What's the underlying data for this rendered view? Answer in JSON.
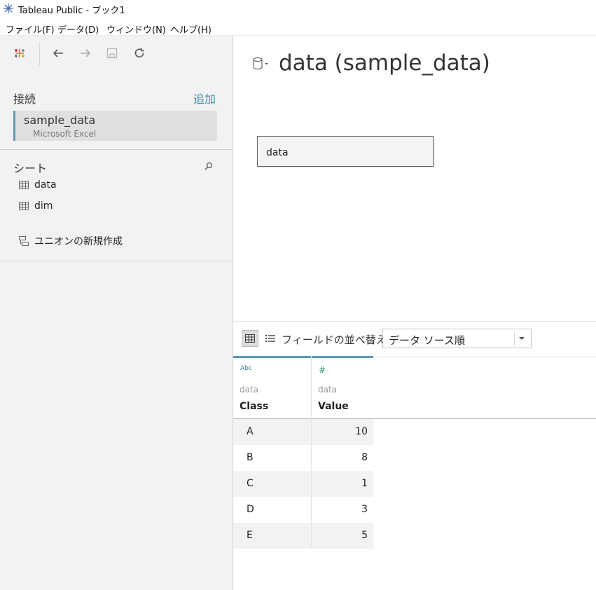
{
  "window": {
    "title": "Tableau Public - ブック1"
  },
  "menu": [
    "ファイル(F)",
    "データ(D)",
    "ウィンドウ(N)",
    "ヘルプ(H)"
  ],
  "toolbar": {
    "icons": [
      "tableau-logo-icon",
      "back-arrow-icon",
      "forward-arrow-icon",
      "save-icon",
      "refresh-icon"
    ]
  },
  "sidebar": {
    "connections_heading": "接続",
    "add_link": "追加",
    "connection": {
      "name": "sample_data",
      "type": "Microsoft Excel"
    },
    "sheets_heading": "シート",
    "sheets": [
      "data",
      "dim"
    ],
    "new_union": "ユニオンの新規作成"
  },
  "canvas": {
    "datasource_title": "data (sample_data)",
    "table_chip": "data"
  },
  "grid_toolbar": {
    "sort_label": "フィールドの並べ替え",
    "sort_value": "データ ソース順"
  },
  "grid": {
    "columns": [
      {
        "type": "Abc",
        "source": "data",
        "name": "Class"
      },
      {
        "type": "#",
        "source": "data",
        "name": "Value"
      }
    ],
    "rows": [
      {
        "class": "A",
        "value": "10"
      },
      {
        "class": "B",
        "value": "8"
      },
      {
        "class": "C",
        "value": "1"
      },
      {
        "class": "D",
        "value": "3"
      },
      {
        "class": "E",
        "value": "5"
      }
    ]
  },
  "colors": {
    "accent": "#5b9bb3",
    "link": "#3f8ea8",
    "panel": "#f2f2f2"
  }
}
